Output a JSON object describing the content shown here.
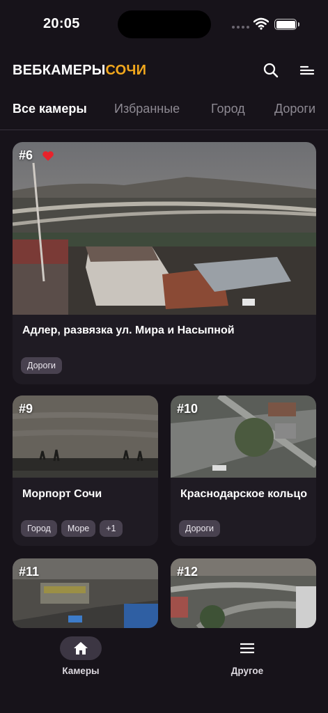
{
  "status": {
    "time": "20:05"
  },
  "header": {
    "logo_part1": "ВЕБКАМЕРЫ",
    "logo_part2": "СОЧИ"
  },
  "tabs": [
    {
      "label": "Все камеры",
      "active": true
    },
    {
      "label": "Избранные"
    },
    {
      "label": "Город"
    },
    {
      "label": "Дороги"
    }
  ],
  "cameras": [
    {
      "number": "#6",
      "favorite": true,
      "title": "Адлер, развязка ул. Мира и Насыпной",
      "tags": [
        "Дороги"
      ]
    },
    {
      "number": "#9",
      "title": "Морпорт Сочи",
      "tags": [
        "Город",
        "Море",
        "+1"
      ]
    },
    {
      "number": "#10",
      "title": "Краснодарское кольцо",
      "tags": [
        "Дороги"
      ]
    },
    {
      "number": "#11"
    },
    {
      "number": "#12"
    }
  ],
  "bottom_nav": [
    {
      "label": "Камеры",
      "icon": "home-icon",
      "active": true
    },
    {
      "label": "Другое",
      "icon": "menu-icon"
    }
  ],
  "colors": {
    "background": "#17131a",
    "card": "#1f1b23",
    "accent": "#f2a81d",
    "tag": "#48414f",
    "heart": "#e8222b"
  }
}
